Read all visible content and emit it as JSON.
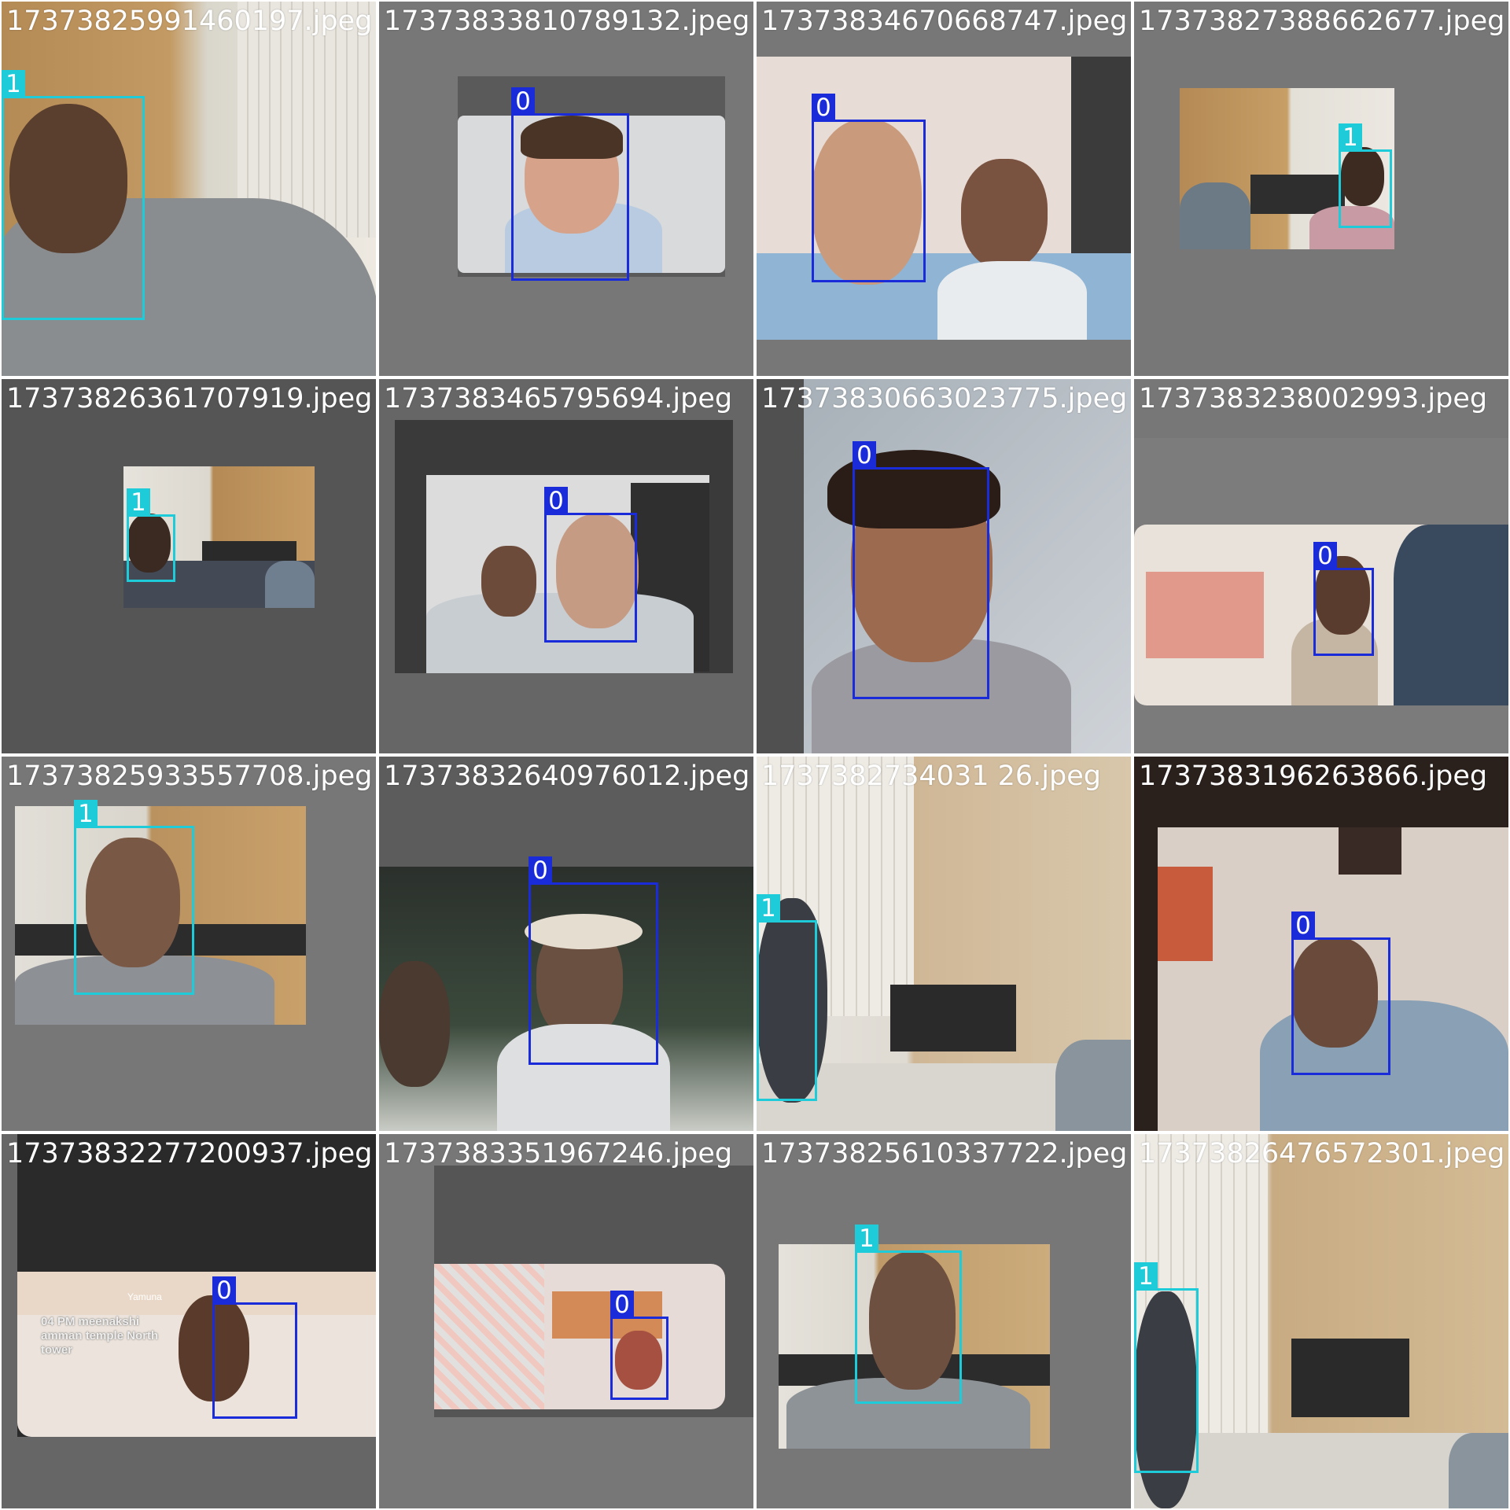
{
  "colors": {
    "class0": "#1a2bd9",
    "class1": "#1ecbd8",
    "tile_bg": "#777777",
    "label_text": "#ffffff"
  },
  "tiles": [
    {
      "filename": "17373825991460197.jpeg",
      "boxes": [
        {
          "label": "1",
          "cls": "1"
        }
      ]
    },
    {
      "filename": "17373833810789132.jpeg",
      "boxes": [
        {
          "label": "0",
          "cls": "0"
        }
      ]
    },
    {
      "filename": "17373834670668747.jpeg",
      "boxes": [
        {
          "label": "0",
          "cls": "0"
        }
      ]
    },
    {
      "filename": "17373827388662677.jpeg",
      "boxes": [
        {
          "label": "1",
          "cls": "1"
        }
      ]
    },
    {
      "filename": "17373826361707919.jpeg",
      "boxes": [
        {
          "label": "1",
          "cls": "1"
        }
      ]
    },
    {
      "filename": "1737383465795694.jpeg",
      "boxes": [
        {
          "label": "0",
          "cls": "0"
        }
      ]
    },
    {
      "filename": "17373830663023775.jpeg",
      "boxes": [
        {
          "label": "0",
          "cls": "0"
        }
      ]
    },
    {
      "filename": "1737383238002993.jpeg",
      "boxes": [
        {
          "label": "0",
          "cls": "0"
        }
      ]
    },
    {
      "filename": "17373825933557708.jpeg",
      "boxes": [
        {
          "label": "1",
          "cls": "1"
        }
      ]
    },
    {
      "filename": "17373832640976012.jpeg",
      "boxes": [
        {
          "label": "0",
          "cls": "0"
        }
      ]
    },
    {
      "filename": "1737382734031 26.jpeg",
      "boxes": [
        {
          "label": "1",
          "cls": "1"
        }
      ]
    },
    {
      "filename": "1737383196263866.jpeg",
      "boxes": [
        {
          "label": "0",
          "cls": "0"
        }
      ]
    },
    {
      "filename": "17373832277200937.jpeg",
      "boxes": [
        {
          "label": "0",
          "cls": "0"
        }
      ]
    },
    {
      "filename": "1737383351967246.jpeg",
      "boxes": [
        {
          "label": "0",
          "cls": "0"
        }
      ]
    },
    {
      "filename": "17373825610337722.jpeg",
      "boxes": [
        {
          "label": "1",
          "cls": "1"
        }
      ]
    },
    {
      "filename": "17373826476572301.jpeg",
      "boxes": [
        {
          "label": "1",
          "cls": "1"
        }
      ]
    }
  ],
  "screen_overlay_text": "04 PM meenakshi amman temple North tower",
  "screen_overlay_logo": "Yamuna"
}
